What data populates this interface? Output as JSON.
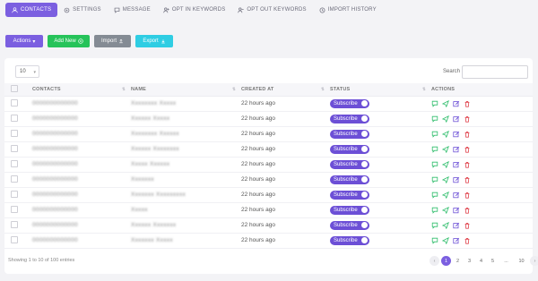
{
  "tabs": [
    {
      "label": "CONTACTS",
      "icon": "user-icon",
      "active": true
    },
    {
      "label": "SETTINGS",
      "icon": "gear-icon",
      "active": false
    },
    {
      "label": "MESSAGE",
      "icon": "chat-icon",
      "active": false
    },
    {
      "label": "OPT IN KEYWORDS",
      "icon": "user-plus-icon",
      "active": false
    },
    {
      "label": "OPT OUT KEYWORDS",
      "icon": "user-minus-icon",
      "active": false
    },
    {
      "label": "IMPORT HISTORY",
      "icon": "history-icon",
      "active": false
    }
  ],
  "toolbar": {
    "actions_label": "Actions",
    "add_new_label": "Add New",
    "import_label": "Import",
    "export_label": "Export"
  },
  "table": {
    "page_length": "10",
    "search_label": "Search",
    "search_value": "",
    "columns": [
      "CONTACTS",
      "NAME",
      "CREATED AT",
      "STATUS",
      "ACTIONS"
    ],
    "rows": [
      {
        "contact": "0000000000000",
        "name": "Xxxxxxxx Xxxxx",
        "created": "22 hours ago",
        "status": "Subscribe"
      },
      {
        "contact": "0000000000000",
        "name": "Xxxxxx Xxxxx",
        "created": "22 hours ago",
        "status": "Subscribe"
      },
      {
        "contact": "0000000000000",
        "name": "Xxxxxxxx Xxxxxx",
        "created": "22 hours ago",
        "status": "Subscribe"
      },
      {
        "contact": "0000000000000",
        "name": "Xxxxxx Xxxxxxxx",
        "created": "22 hours ago",
        "status": "Subscribe"
      },
      {
        "contact": "0000000000000",
        "name": "Xxxxx Xxxxxx",
        "created": "22 hours ago",
        "status": "Subscribe"
      },
      {
        "contact": "0000000000000",
        "name": "Xxxxxxx",
        "created": "22 hours ago",
        "status": "Subscribe"
      },
      {
        "contact": "0000000000000",
        "name": "Xxxxxxx Xxxxxxxxx",
        "created": "22 hours ago",
        "status": "Subscribe"
      },
      {
        "contact": "0000000000000",
        "name": "Xxxxx",
        "created": "22 hours ago",
        "status": "Subscribe"
      },
      {
        "contact": "0000000000000",
        "name": "Xxxxxx Xxxxxxx",
        "created": "22 hours ago",
        "status": "Subscribe"
      },
      {
        "contact": "0000000000000",
        "name": "Xxxxxxx Xxxxx",
        "created": "22 hours ago",
        "status": "Subscribe"
      }
    ],
    "info_text": "Showing 1 to 10 of 100 entries",
    "pagination": [
      "‹",
      "1",
      "2",
      "3",
      "4",
      "5",
      "...",
      "10",
      "›"
    ],
    "current_page": "1"
  },
  "colors": {
    "accent": "#7b5fe0",
    "badge": "#6c4fd6",
    "add_new": "#26c35a",
    "import": "#848b94",
    "export": "#2fcde3",
    "action_green": "#2ebd6b",
    "action_purple": "#6c4fd6",
    "action_red": "#e0454f"
  }
}
